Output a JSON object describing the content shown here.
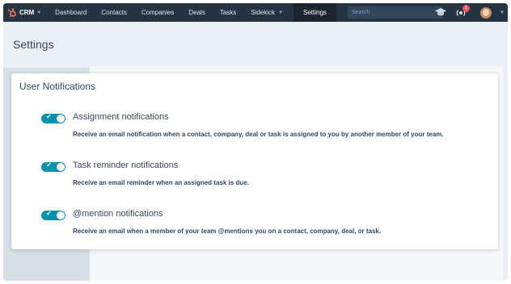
{
  "nav": {
    "brand": "CRM",
    "items": [
      "Dashboard",
      "Contacts",
      "Companies",
      "Deals",
      "Tasks",
      "Sidekick"
    ],
    "active": "Settings",
    "search_placeholder": "Search",
    "notification_count": "1",
    "colors": {
      "bar": "#253342",
      "logo": "#ff7a59"
    }
  },
  "page": {
    "title": "Settings"
  },
  "card": {
    "title": "User Notifications",
    "rows": [
      {
        "title": "Assignment notifications",
        "description": "Receive an email notification when a contact, company, deal or task is assigned to you by another member of your team.",
        "enabled": true
      },
      {
        "title": "Task reminder notifications",
        "description": "Receive an email reminder when an assigned task is due.",
        "enabled": true
      },
      {
        "title": "@mention notifications",
        "description": "Receive an email when a member of your team @mentions you on a contact, company, deal, or task.",
        "enabled": true
      }
    ]
  },
  "toggle_color": "#0091ae"
}
